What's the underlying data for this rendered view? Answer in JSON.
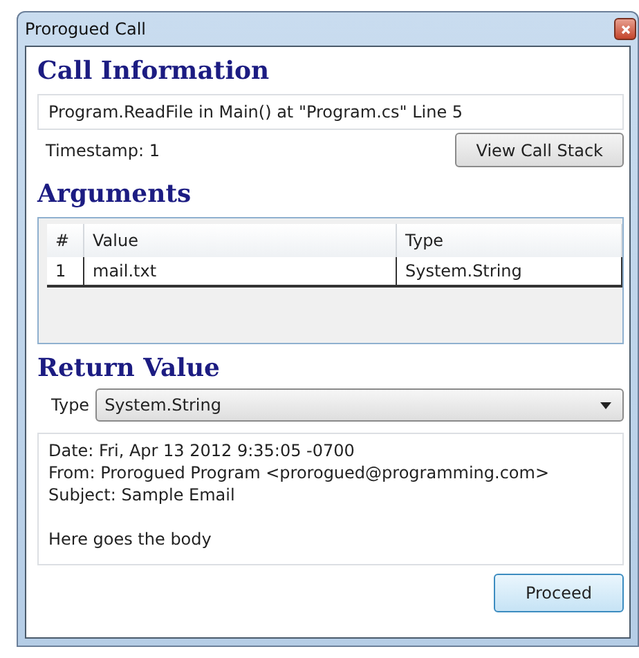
{
  "window": {
    "title": "Prorogued Call"
  },
  "call_information": {
    "heading": "Call Information",
    "location": "Program.ReadFile in Main() at \"Program.cs\" Line 5",
    "timestamp": "Timestamp: 1",
    "view_call_stack_button": "View Call Stack"
  },
  "arguments": {
    "heading": "Arguments",
    "columns": [
      "#",
      "Value",
      "Type"
    ],
    "rows": [
      {
        "cells": [
          "1",
          "mail.txt",
          "System.String"
        ],
        "selected": true
      }
    ]
  },
  "return_value": {
    "heading": "Return Value",
    "type_label": "Type",
    "type_value": "System.String",
    "header_lines": [
      "Date: Fri, Apr 13 2012 9:35:05 -0700",
      "From: Prorogued Program <prorogued@programming.com>",
      "Subject: Sample Email"
    ],
    "body": "Here goes the body"
  },
  "buttons": [
    "Proceed"
  ]
}
